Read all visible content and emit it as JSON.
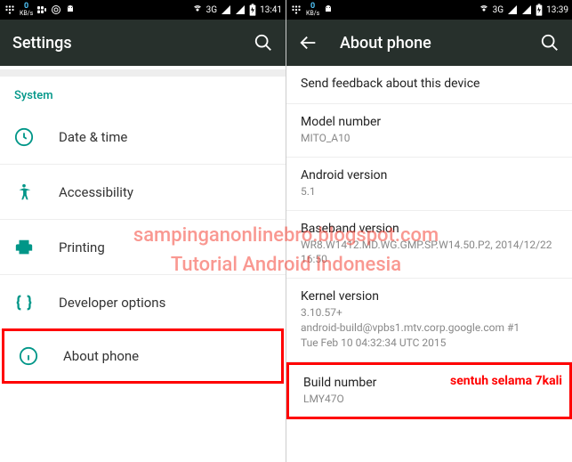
{
  "left": {
    "status": {
      "data_val": "0",
      "data_unit": "KB/s",
      "net": "3G",
      "time": "13:41"
    },
    "title": "Settings",
    "section": "System",
    "items": [
      {
        "label": "Date & time"
      },
      {
        "label": "Accessibility"
      },
      {
        "label": "Printing"
      },
      {
        "label": "Developer options"
      },
      {
        "label": "About phone"
      }
    ]
  },
  "right": {
    "status": {
      "data_val": "0",
      "data_unit": "KB/s",
      "net": "3G",
      "time": "13:39"
    },
    "title": "About phone",
    "feedback": "Send feedback about this device",
    "rows": [
      {
        "label": "Model number",
        "value": "MITO_A10"
      },
      {
        "label": "Android version",
        "value": "5.1"
      },
      {
        "label": "Baseband version",
        "value": "WR8.W1412.MD.WG.GMP.SP.W14.50.P2, 2014/12/22 16:50"
      },
      {
        "label": "Kernel version",
        "value": "3.10.57+\nandroid-build@vpbs1.mtv.corp.google.com #1\nTue Feb 10 04:32:34 UTC 2015"
      },
      {
        "label": "Build number",
        "value": "LMY47O"
      }
    ],
    "annotation": "sentuh selama 7kali"
  },
  "watermark": {
    "line1": "sampinganonlinebro.blogspot.com",
    "line2": "Tutorial Android Indonesia"
  }
}
